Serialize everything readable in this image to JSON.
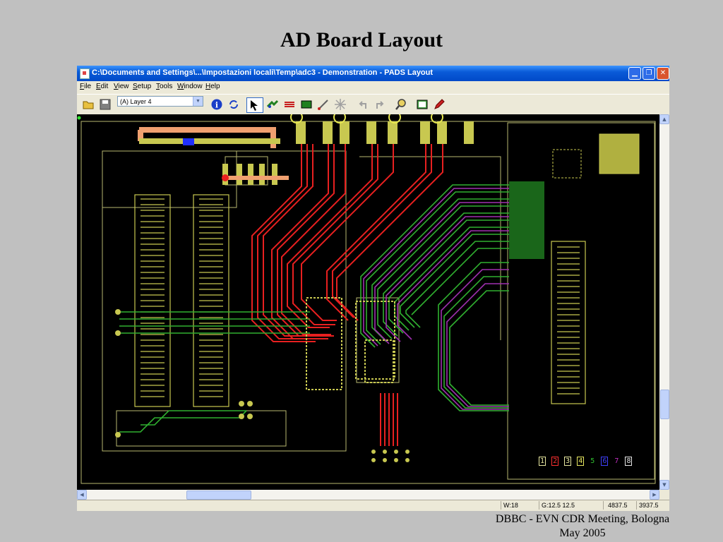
{
  "slide": {
    "title": "AD Board Layout",
    "footer_line1": "DBBC -  EVN CDR Meeting, Bologna",
    "footer_line2": "May 2005"
  },
  "window": {
    "title": "C:\\Documents and Settings\\...\\Impostazioni locali\\Temp\\adc3 - Demonstration - PADS Layout",
    "minimize_icon": "minimize-icon",
    "restore_icon": "restore-icon",
    "close_icon": "close-icon"
  },
  "menu": [
    "File",
    "Edit",
    "View",
    "Setup",
    "Tools",
    "Window",
    "Help"
  ],
  "toolbar": {
    "layer_value": "(A) Layer 4",
    "icons": [
      "open-folder-icon",
      "save-icon",
      "info-icon",
      "refresh-icon",
      "select-arrow-icon",
      "route-icon",
      "auto-route-icon",
      "board-icon",
      "measure-icon",
      "spark-icon",
      "undo-icon",
      "redo-icon",
      "zoom-icon",
      "bulletin-icon",
      "pencil-icon"
    ]
  },
  "layer_indicators": [
    {
      "label": "1",
      "color": "#e8e8a0"
    },
    {
      "label": "2",
      "color": "#ff3030"
    },
    {
      "label": "3",
      "color": "#e8e8a0"
    },
    {
      "label": "4",
      "color": "#e8e860"
    },
    {
      "label": "5",
      "color": "#30c030"
    },
    {
      "label": "6",
      "color": "#4040ff"
    },
    {
      "label": "7",
      "color": "#c030c0"
    },
    {
      "label": "8",
      "color": "#e8e8e8"
    }
  ],
  "status": {
    "width": "W:18",
    "grid": "G:12.5 12.5",
    "x": "4837.5",
    "y": "3937.5"
  },
  "colors": {
    "trace_red": "#e82020",
    "trace_green": "#30b030",
    "trace_purple": "#a030b0",
    "pad_yellow": "#c8c850",
    "outline": "#b8b870"
  }
}
